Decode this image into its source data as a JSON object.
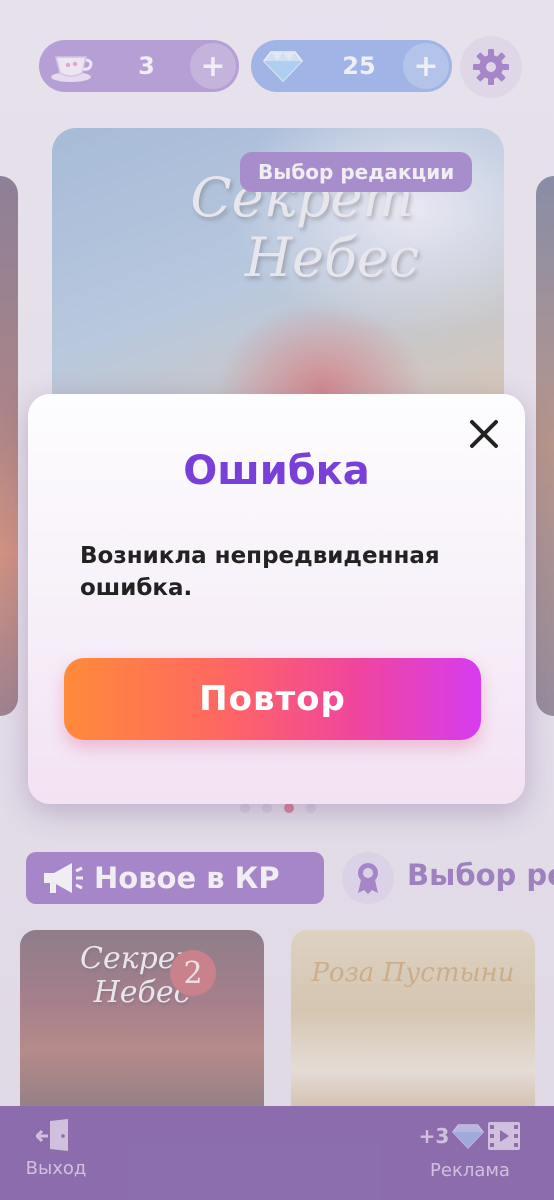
{
  "topbar": {
    "tea_count": "3",
    "gem_count": "25",
    "plus_label": "+"
  },
  "hero": {
    "badge": "Выбор редакции",
    "title_line1": "Секрет",
    "title_line2": "Небес"
  },
  "carousel": {
    "dot_count": 4,
    "active_index": 2
  },
  "sections": {
    "new_label": "Новое в КР",
    "pick_label": "Выбор ред"
  },
  "books": [
    {
      "title_line1": "Секрет",
      "title_line2": "Небес",
      "number": "2"
    },
    {
      "title": "Роза Пустыни"
    }
  ],
  "bottom_bar": {
    "exit_label": "Выход",
    "ad_reward": "+3",
    "ad_label": "Реклама"
  },
  "dialog": {
    "title": "Ошибка",
    "message": "Возникла непредвиденная ошибка.",
    "retry_label": "Повтор"
  },
  "colors": {
    "accent_purple": "#7a3fd8",
    "bottom_bar": "#4a1f7d",
    "tea_pill": "#8a63c0",
    "gem_pill": "#5f8fe3",
    "retry_gradient_start": "#ff8a3a",
    "retry_gradient_end": "#d63cf0"
  },
  "icons": {
    "tea": "teacup-icon",
    "gem": "diamond-icon",
    "settings": "gear-icon",
    "close": "close-icon",
    "megaphone": "megaphone-icon",
    "award": "award-icon",
    "exit": "exit-door-icon",
    "video": "video-film-icon"
  }
}
